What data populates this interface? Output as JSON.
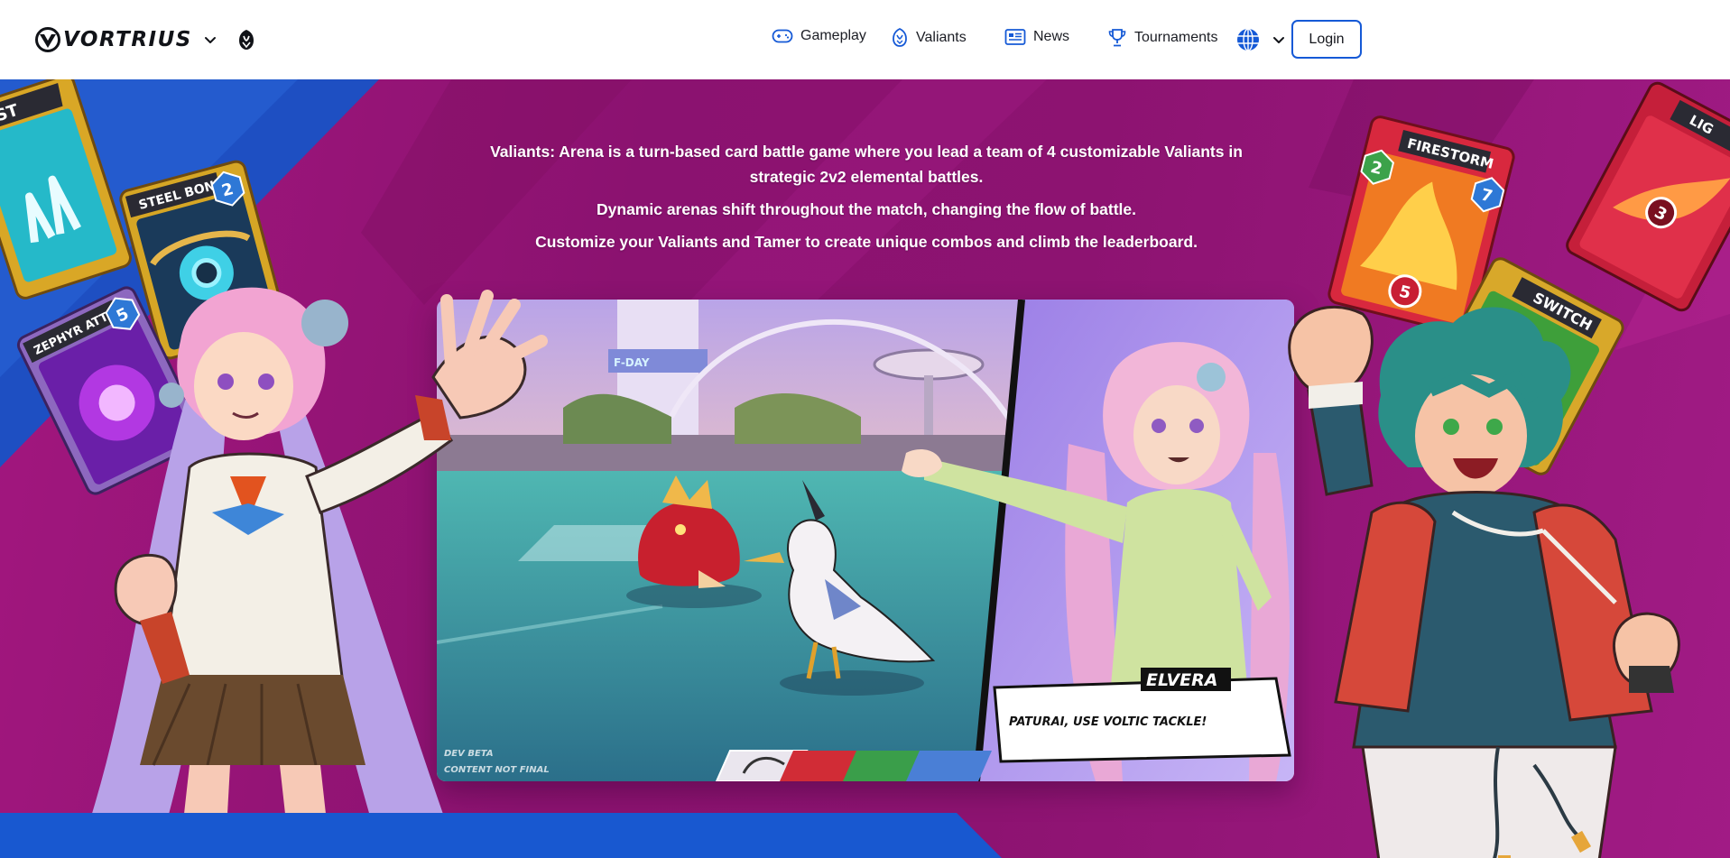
{
  "brand": {
    "name": "VORTRIUS",
    "logo_icon": "vortrius-logo-icon",
    "menu_icon": "chevron-down-icon",
    "game_icon": "valiants-crest-icon"
  },
  "nav": {
    "items": [
      {
        "label": "Gameplay",
        "icon": "gamepad-icon"
      },
      {
        "label": "Valiants",
        "icon": "valiants-crest-icon"
      },
      {
        "label": "News",
        "icon": "newspaper-icon"
      },
      {
        "label": "Tournaments",
        "icon": "trophy-icon"
      }
    ],
    "language_icon": "globe-icon",
    "login_label": "Login"
  },
  "hero": {
    "intro": [
      "Valiants: Arena is a turn-based card battle game where you lead a team of 4 customizable Valiants in strategic 2v2 elemental battles.",
      "Dynamic arenas shift throughout the match, changing the flow of battle.",
      "Customize your Valiants and Tamer to create unique combos and climb the leaderboard."
    ],
    "screenshot": {
      "speaker_name": "ELVERA",
      "speech": "PATURAI, USE VOLTIC TACKLE!",
      "watermark_line1": "DEV BETA",
      "watermark_line2": "CONTENT NOT FINAL",
      "arena_sign": "F-DAY"
    },
    "cards": [
      {
        "name": "EST",
        "cost": ""
      },
      {
        "name": "STEEL BOND",
        "cost": "2"
      },
      {
        "name": "ZEPHYR ATTACK",
        "cost": "5"
      },
      {
        "name": "FIRESTORM",
        "cost": "2",
        "power": "7",
        "value": "5"
      },
      {
        "name": "LIG",
        "value": "3"
      },
      {
        "name": "SWITCH",
        "cost": ""
      }
    ]
  },
  "colors": {
    "accent_blue": "#1559d6",
    "hero_magenta": "#9a167a",
    "hero_blue": "#1e58c8"
  }
}
